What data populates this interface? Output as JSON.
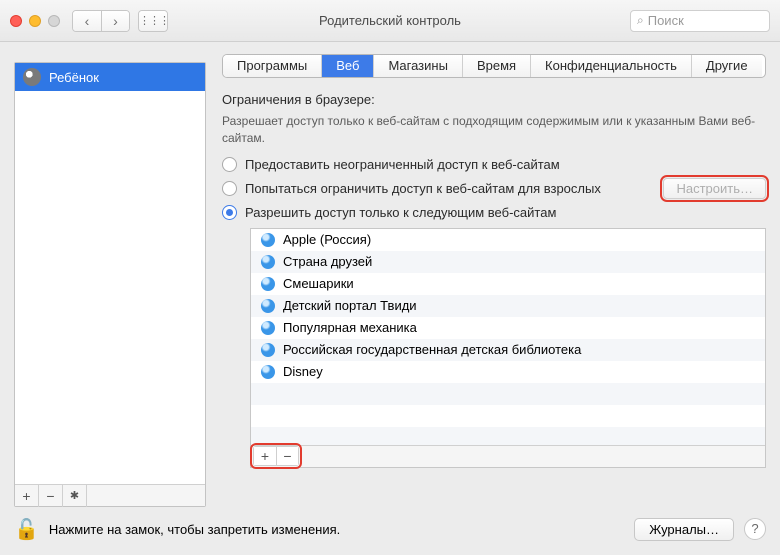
{
  "window": {
    "title": "Родительский контроль",
    "search_placeholder": "Поиск"
  },
  "tabs": [
    {
      "label": "Программы",
      "active": false
    },
    {
      "label": "Веб",
      "active": true
    },
    {
      "label": "Магазины",
      "active": false
    },
    {
      "label": "Время",
      "active": false
    },
    {
      "label": "Конфиденциальность",
      "active": false
    },
    {
      "label": "Другие",
      "active": false
    }
  ],
  "sidebar": {
    "user": "Ребёнок"
  },
  "web": {
    "section_title": "Ограничения в браузере:",
    "description": "Разрешает доступ только к веб-сайтам с подходящим содержимым или к указанным Вами веб-сайтам.",
    "options": [
      {
        "label": "Предоставить неограниченный доступ к веб-сайтам",
        "selected": false
      },
      {
        "label": "Попытаться ограничить доступ к веб-сайтам для взрослых",
        "selected": false
      },
      {
        "label": "Разрешить доступ только к следующим веб-сайтам",
        "selected": true
      }
    ],
    "customize_button": "Настроить…",
    "sites": [
      "Apple (Россия)",
      "Страна друзей",
      "Смешарики",
      "Детский портал Твиди",
      "Популярная механика",
      "Российская государственная детская библиотека",
      "Disney"
    ]
  },
  "footer": {
    "lock_text": "Нажмите на замок, чтобы запретить изменения.",
    "journals_button": "Журналы…"
  },
  "glyphs": {
    "back": "‹",
    "forward": "›",
    "grid": "⋮⋮⋮",
    "plus": "+",
    "minus": "−",
    "gear": "✱",
    "lock": "🔓",
    "help": "?",
    "search": "⌕"
  }
}
